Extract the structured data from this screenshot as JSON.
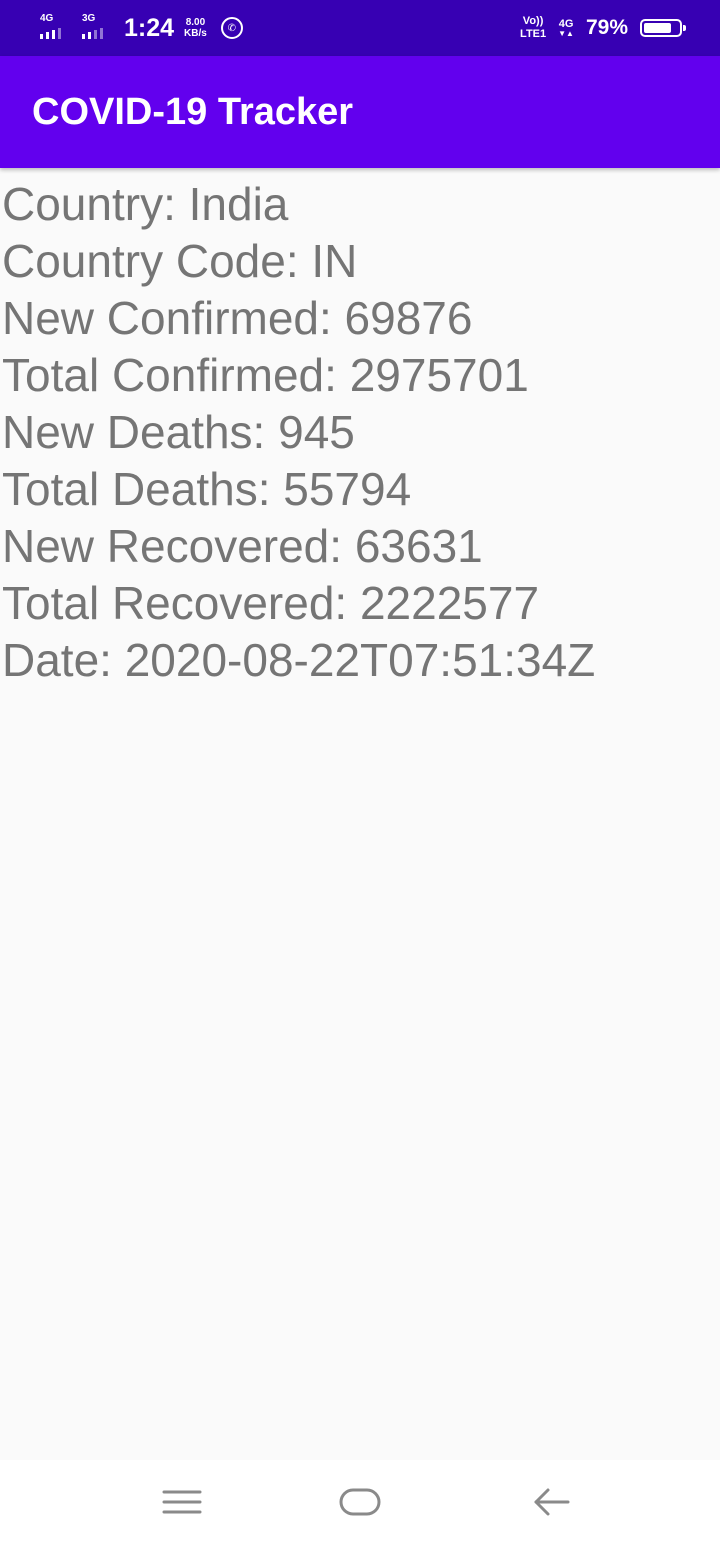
{
  "status_bar": {
    "sim1_network": "4G",
    "sim2_network": "3G",
    "time": "1:24",
    "speed_value": "8.00",
    "speed_unit": "KB/s",
    "volte_top": "Vo))",
    "volte_bottom": "LTE1",
    "right_network": "4G",
    "battery_percent": "79%",
    "battery_level": 0.79,
    "icons": [
      "signal-icon",
      "whatsapp-icon",
      "battery-icon"
    ]
  },
  "app_bar": {
    "title": "COVID-19 Tracker",
    "color": "#6200ee",
    "status_color": "#3700b3"
  },
  "stats": [
    {
      "text": "Country: India"
    },
    {
      "text": "Country Code: IN"
    },
    {
      "text": "New Confirmed: 69876"
    },
    {
      "text": "Total Confirmed: 2975701"
    },
    {
      "text": "New Deaths: 945"
    },
    {
      "text": "Total Deaths: 55794"
    },
    {
      "text": "New Recovered: 63631"
    },
    {
      "text": "Total Recovered: 2222577"
    },
    {
      "text": "Date: 2020-08-22T07:51:34Z"
    }
  ],
  "nav_bar": {
    "icons": [
      "menu-icon",
      "home-icon",
      "back-icon"
    ]
  }
}
